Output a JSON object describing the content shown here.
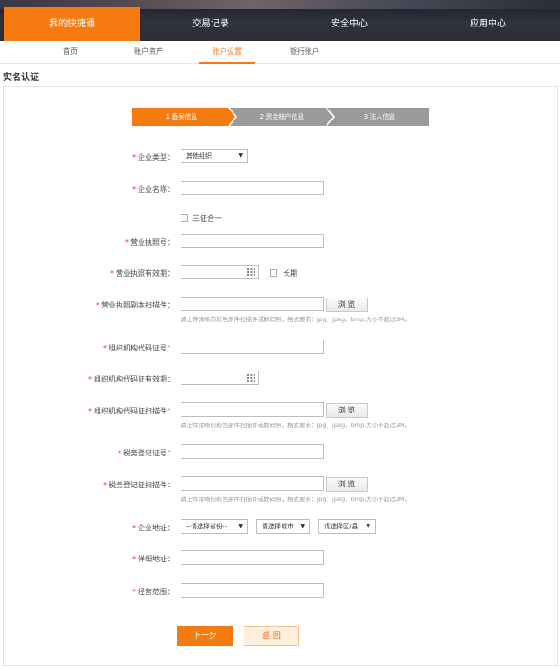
{
  "nav": {
    "tabs": [
      {
        "label": "我的快捷通",
        "active": true
      },
      {
        "label": "交易记录",
        "active": false
      },
      {
        "label": "安全中心",
        "active": false
      },
      {
        "label": "应用中心",
        "active": false
      }
    ]
  },
  "subnav": {
    "items": [
      {
        "label": "首页",
        "active": false
      },
      {
        "label": "账户资产",
        "active": false
      },
      {
        "label": "账户设置",
        "active": true
      },
      {
        "label": "银行账户",
        "active": false
      }
    ]
  },
  "section_title": "实名认证",
  "steps": [
    {
      "label": "1 备案信息",
      "active": true
    },
    {
      "label": "2 资金账户信息",
      "active": false
    },
    {
      "label": "3 法人信息",
      "active": false
    }
  ],
  "colors": {
    "accent": "#f57a0f",
    "step_inactive": "#9a9a9a",
    "required": "#e33333"
  },
  "form": {
    "required_mark": "*",
    "company_type": {
      "label": "企业类型：",
      "value": "其他组织"
    },
    "company_name": {
      "label": "企业名称：",
      "value": ""
    },
    "three_in_one": {
      "label": "三证合一",
      "checked": false
    },
    "license_no": {
      "label": "营业执照号：",
      "value": ""
    },
    "license_validity": {
      "label": "营业执照有效期：",
      "value": "",
      "long_term_label": "长期",
      "long_term_checked": false
    },
    "license_scan": {
      "label": "营业执照副本扫描件：",
      "browse_label": "浏 览",
      "hint": "请上传清晰的彩色原件扫描件或数码照，格式要求：jpg、jpeg、bmp,大小不超过2M。"
    },
    "org_code": {
      "label": "组织机构代码证号：",
      "value": ""
    },
    "org_code_validity": {
      "label": "组织机构代码证有效期：",
      "value": ""
    },
    "org_code_scan": {
      "label": "组织机构代码证扫描件：",
      "browse_label": "浏 览",
      "hint": "请上传清晰的彩色原件扫描件或数码照，格式要求：jpg、jpeg、bmp,大小不超过2M。"
    },
    "tax_no": {
      "label": "税务登记证号：",
      "value": ""
    },
    "tax_scan": {
      "label": "税务登记证扫描件：",
      "browse_label": "浏 览",
      "hint": "请上传清晰的彩色原件扫描件或数码照，格式要求：jpg、jpeg、bmp,大小不超过2M。"
    },
    "address": {
      "label": "企业地址：",
      "province": "--请选择省份--",
      "city": "请选择城市",
      "district": "请选择区/县"
    },
    "detail_address": {
      "label": "详细地址：",
      "value": ""
    },
    "business_scope": {
      "label": "经营范围：",
      "value": ""
    }
  },
  "buttons": {
    "next": "下一步",
    "back": "返 回"
  }
}
